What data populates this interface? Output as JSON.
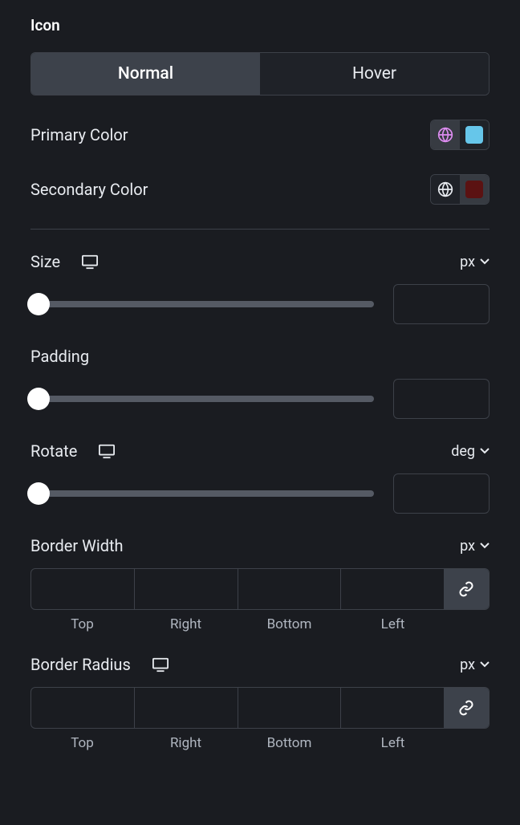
{
  "section": {
    "title": "Icon"
  },
  "tabs": {
    "normal": "Normal",
    "hover": "Hover",
    "active": "normal"
  },
  "primaryColor": {
    "label": "Primary Color",
    "globeColor": "#dd8cf0",
    "swatch": "#66c6ea",
    "globeActive": true
  },
  "secondaryColor": {
    "label": "Secondary Color",
    "globeColor": "#e8ebf0",
    "swatch": "#5b1212",
    "swatchActive": true
  },
  "size": {
    "label": "Size",
    "unit": "px",
    "value": ""
  },
  "padding": {
    "label": "Padding",
    "value": ""
  },
  "rotate": {
    "label": "Rotate",
    "unit": "deg",
    "value": ""
  },
  "borderWidth": {
    "label": "Border Width",
    "unit": "px",
    "sides": {
      "top": "Top",
      "right": "Right",
      "bottom": "Bottom",
      "left": "Left"
    }
  },
  "borderRadius": {
    "label": "Border Radius",
    "unit": "px",
    "sides": {
      "top": "Top",
      "right": "Right",
      "bottom": "Bottom",
      "left": "Left"
    }
  }
}
